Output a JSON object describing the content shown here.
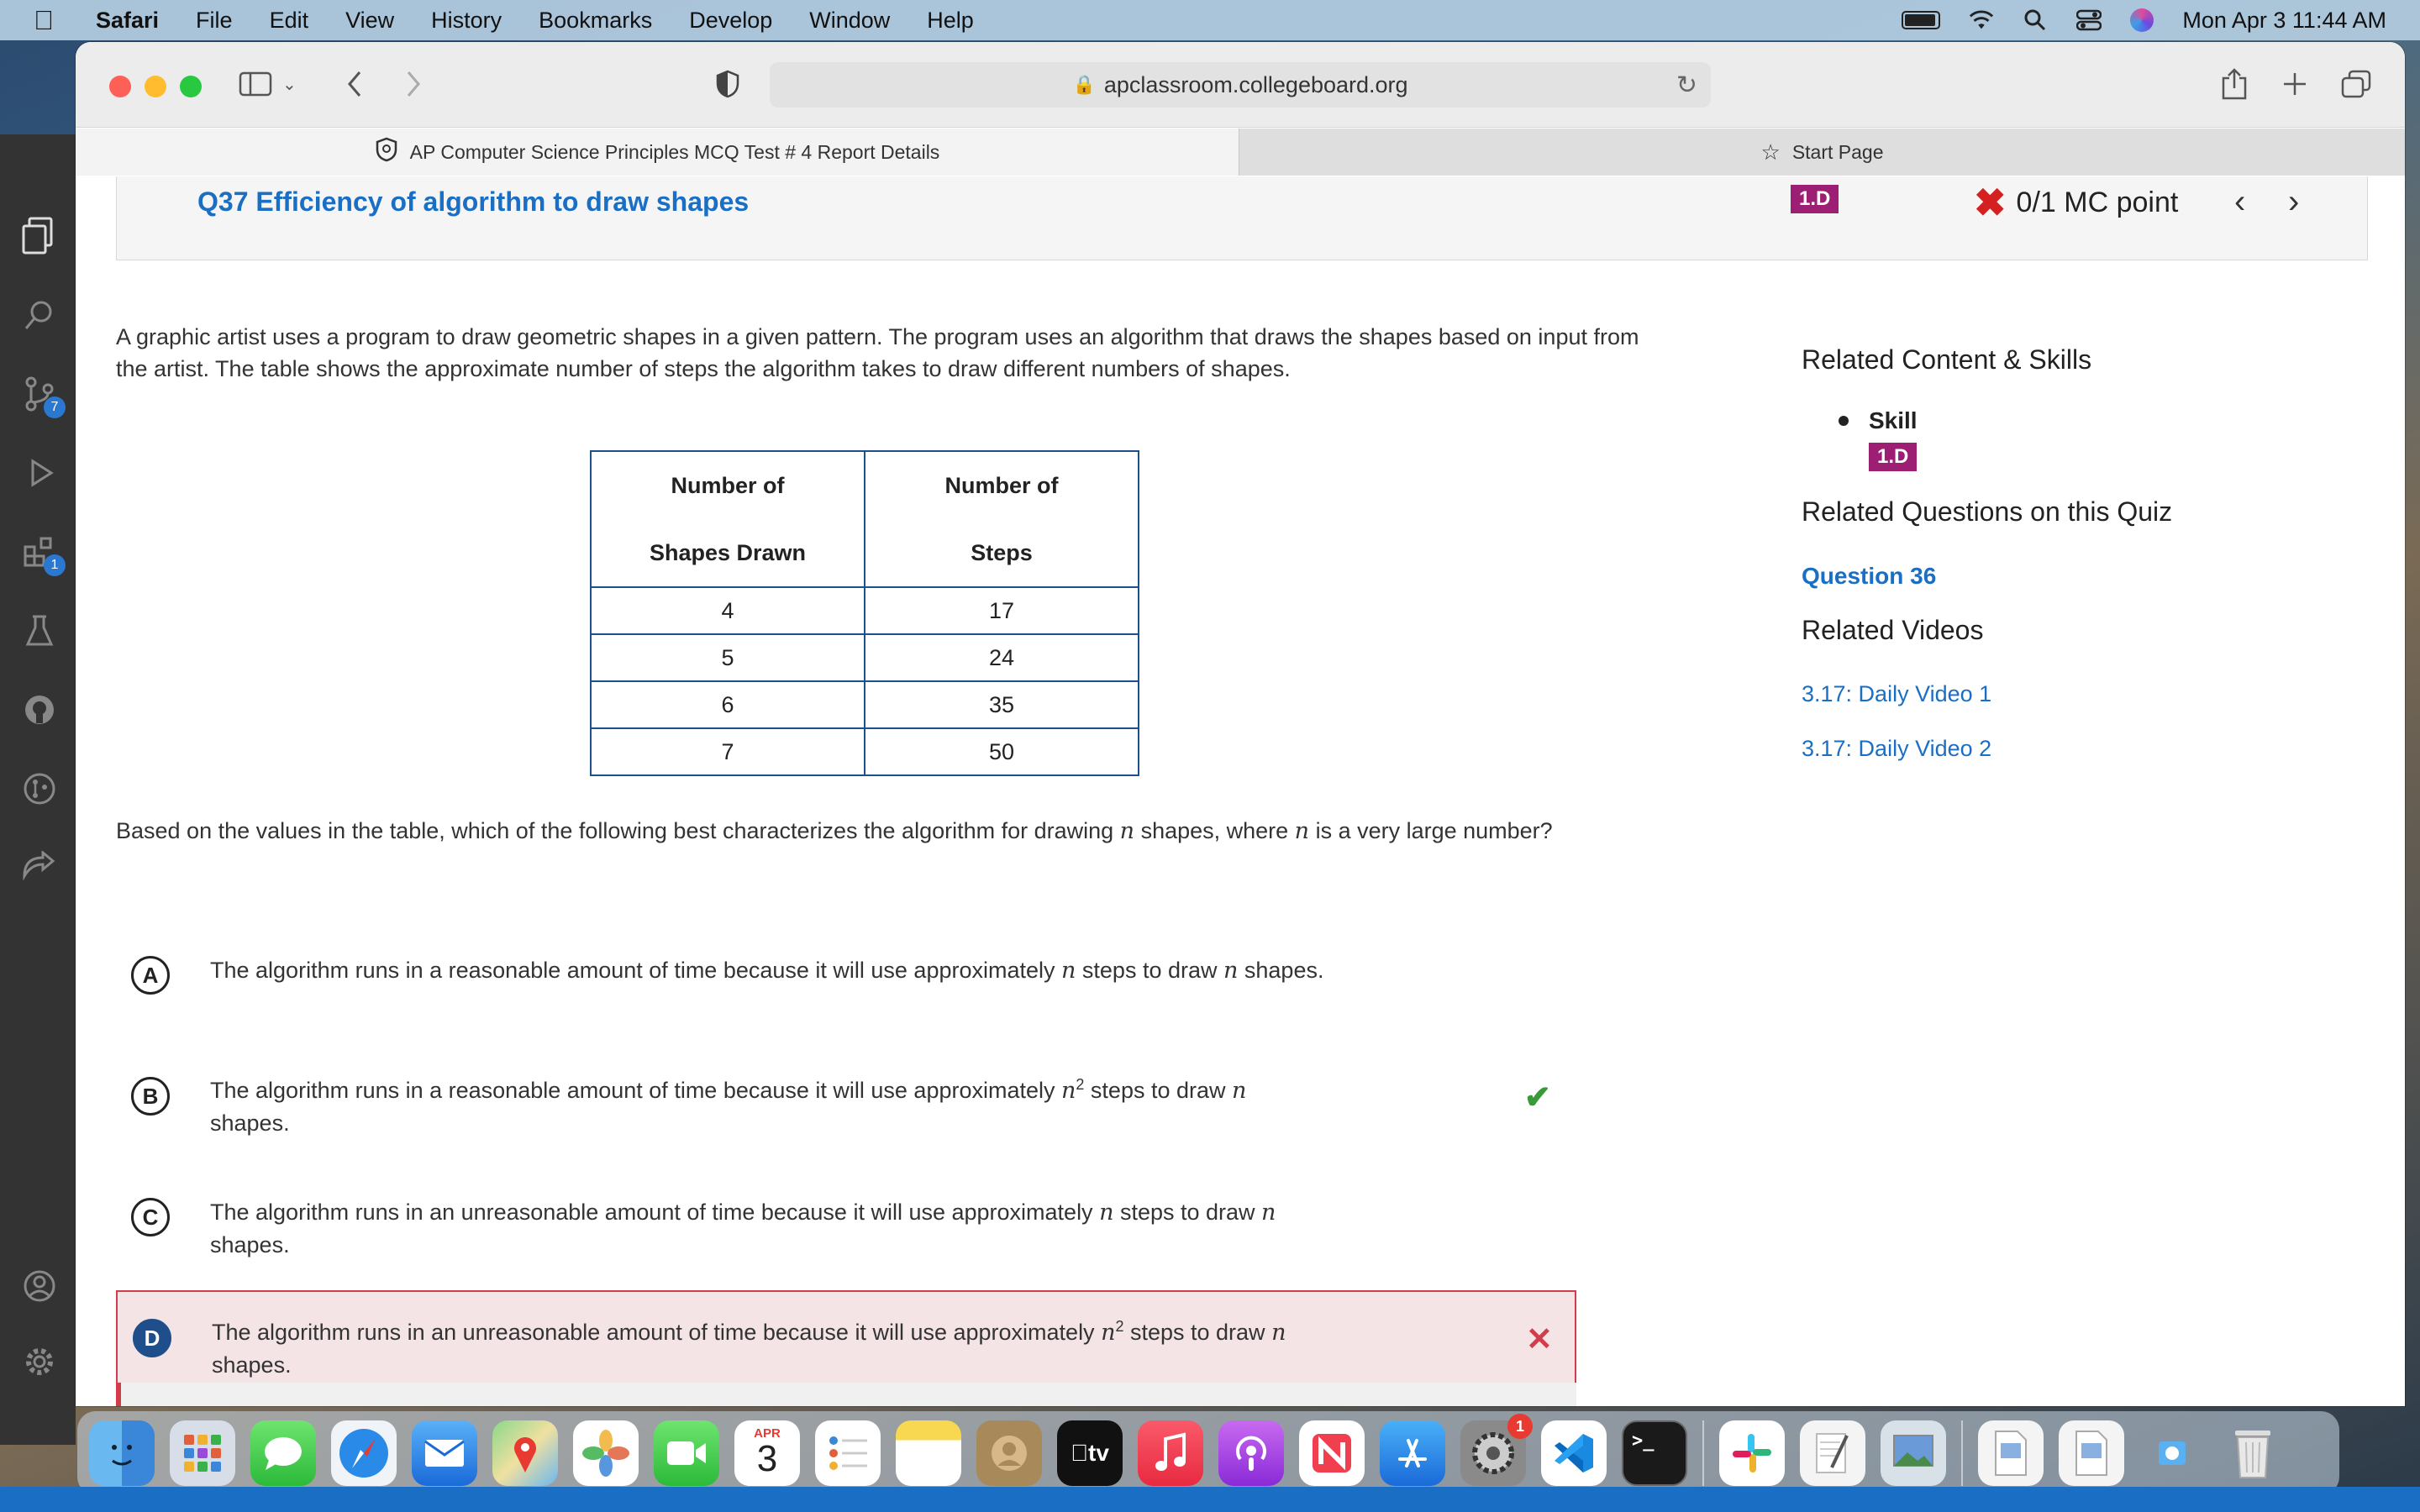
{
  "menubar": {
    "app": "Safari",
    "items": [
      "File",
      "Edit",
      "View",
      "History",
      "Bookmarks",
      "Develop",
      "Window",
      "Help"
    ],
    "clock": "Mon Apr 3  11:44 AM"
  },
  "browser": {
    "url": "apclassroom.collegeboard.org",
    "tabs": [
      {
        "label": "AP Computer Science Principles MCQ Test # 4 Report Details"
      },
      {
        "label": "Start Page"
      }
    ]
  },
  "activity_badges": {
    "source_control": "7",
    "extensions": "1"
  },
  "question": {
    "title": "Q37 Efficiency of algorithm to draw shapes",
    "skill_tag": "1.D",
    "score": "0/1 MC point",
    "stem": "A graphic artist uses a program to draw geometric shapes in a given pattern. The program uses an algorithm that draws the shapes based on input from the artist. The table shows the approximate number of steps the algorithm takes to draw different numbers of shapes.",
    "table": {
      "headers": [
        [
          "Number of",
          "Shapes Drawn"
        ],
        [
          "Number of",
          "Steps"
        ]
      ],
      "rows": [
        [
          "4",
          "17"
        ],
        [
          "5",
          "24"
        ],
        [
          "6",
          "35"
        ],
        [
          "7",
          "50"
        ]
      ]
    },
    "prompt_parts": [
      "Based on the values in the table, which of the following best characterizes the algorithm for drawing ",
      "n",
      " shapes, where ",
      "n",
      " is a very large number?"
    ],
    "choices": [
      {
        "letter": "A",
        "pre": "The algorithm runs in a reasonable amount of time because it will use approximately ",
        "var": "n",
        "sup": "",
        "mid": " steps to draw ",
        "var2": "n",
        "post": " shapes.",
        "state": "none"
      },
      {
        "letter": "B",
        "pre": "The algorithm runs in a reasonable amount of time because it will use approximately ",
        "var": "n",
        "sup": "2",
        "mid": " steps to draw ",
        "var2": "n",
        "post": " shapes.",
        "state": "correct"
      },
      {
        "letter": "C",
        "pre": "The algorithm runs in an unreasonable amount of time because it will use approximately ",
        "var": "n",
        "sup": "",
        "mid": " steps to draw ",
        "var2": "n",
        "post": " shapes.",
        "state": "none"
      },
      {
        "letter": "D",
        "pre": "The algorithm runs in an unreasonable amount of time because it will use approximately ",
        "var": "n",
        "sup": "2",
        "mid": " steps to draw ",
        "var2": "n",
        "post": " shapes.",
        "state": "selected-wrong"
      }
    ]
  },
  "sidebar": {
    "related_heading": "Related Content & Skills",
    "skill_label": "Skill",
    "skill_tag": "1.D",
    "related_questions_heading": "Related Questions on this Quiz",
    "related_question": "Question 36",
    "videos_heading": "Related Videos",
    "videos": [
      "3.17: Daily Video 1",
      "3.17: Daily Video 2"
    ]
  },
  "dock": {
    "calendar_month": "APR",
    "calendar_day": "3",
    "settings_badge": "1",
    "tv_label": "tv"
  },
  "colors": {
    "link": "#1a6fc4",
    "skill_tag": "#9c1f73",
    "wrong": "#d23c4b",
    "correct": "#3a9a3a"
  }
}
